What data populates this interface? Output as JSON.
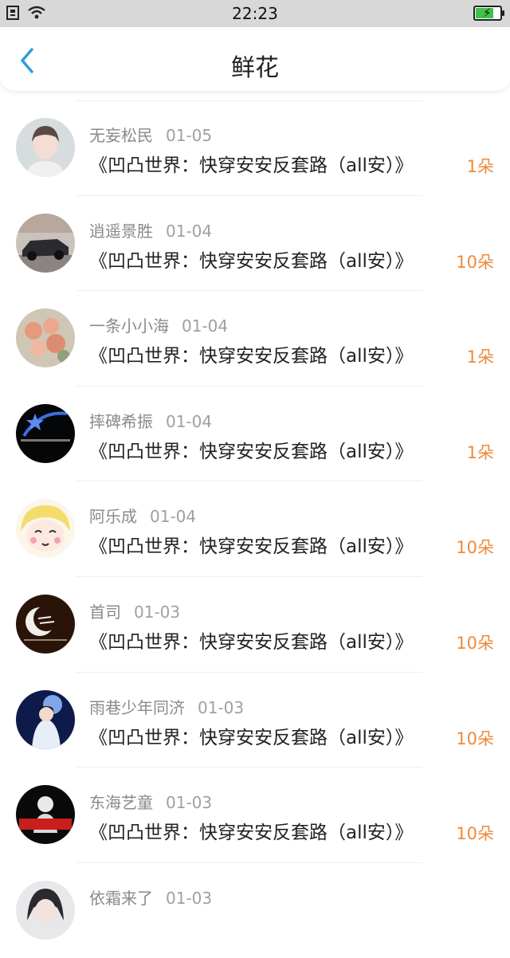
{
  "status": {
    "time": "22:23"
  },
  "nav": {
    "title": "鲜花"
  },
  "unit": "朵",
  "colors": {
    "accent": "#ee8a3a",
    "back": "#2f9ae8"
  },
  "rows": [
    {
      "name": "无妄松民",
      "date": "01-05",
      "book": "《凹凸世界：快穿安安反套路（all安）》",
      "count": "1朵"
    },
    {
      "name": "逍遥景胜",
      "date": "01-04",
      "book": "《凹凸世界：快穿安安反套路（all安）》",
      "count": "10朵"
    },
    {
      "name": "一条小小海",
      "date": "01-04",
      "book": "《凹凸世界：快穿安安反套路（all安）》",
      "count": "1朵"
    },
    {
      "name": "摔碑希振",
      "date": "01-04",
      "book": "《凹凸世界：快穿安安反套路（all安）》",
      "count": "1朵"
    },
    {
      "name": "阿乐成",
      "date": "01-04",
      "book": "《凹凸世界：快穿安安反套路（all安）》",
      "count": "10朵"
    },
    {
      "name": "首司",
      "date": "01-03",
      "book": "《凹凸世界：快穿安安反套路（all安）》",
      "count": "10朵"
    },
    {
      "name": "雨巷少年同济",
      "date": "01-03",
      "book": "《凹凸世界：快穿安安反套路（all安）》",
      "count": "10朵"
    },
    {
      "name": "东海艺童",
      "date": "01-03",
      "book": "《凹凸世界：快穿安安反套路（all安）》",
      "count": "10朵"
    },
    {
      "name": "依霜来了",
      "date": "01-03",
      "book": "",
      "count": ""
    }
  ]
}
